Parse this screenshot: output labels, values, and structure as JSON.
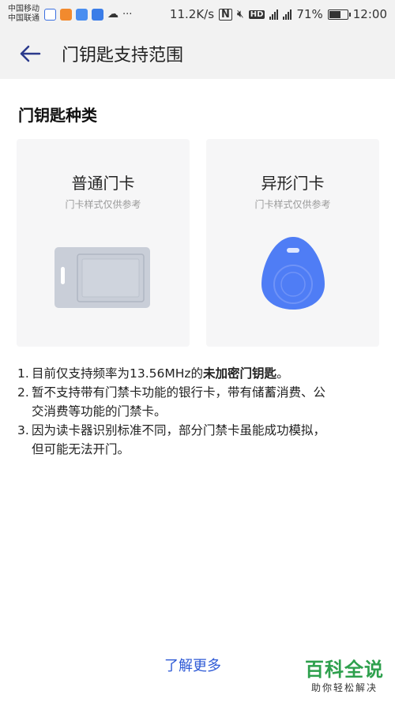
{
  "status_bar": {
    "carrier_1": "中国移动",
    "carrier_2": "中国联通",
    "speed": "11.2K/s",
    "battery": "71%",
    "battery_level": 0.71,
    "time": "12:00",
    "app_icons": [
      "baidu-icon",
      "orange-app-icon",
      "wifi-app-icon",
      "blue-app-icon",
      "cloud-icon"
    ]
  },
  "header": {
    "title": "门钥匙支持范围"
  },
  "section": {
    "title": "门钥匙种类"
  },
  "cards": [
    {
      "title": "普通门卡",
      "subtitle": "门卡样式仅供参考"
    },
    {
      "title": "异形门卡",
      "subtitle": "门卡样式仅供参考"
    }
  ],
  "notes": {
    "n1_num": "1.",
    "n1_text": "目前仅支持频率为13.56MHz的",
    "n1_bold": "未加密门钥匙",
    "n1_end": "。",
    "n2_num": "2.",
    "n2_line1": "暂不支持带有门禁卡功能的银行卡，带有储蓄消费、公",
    "n2_line2": "交消费等功能的门禁卡。",
    "n3_num": "3.",
    "n3_line1": "因为读卡器识别标准不同，部分门禁卡虽能成功模拟，",
    "n3_line2": "但可能无法开门。"
  },
  "footer": {
    "learn_more": "了解更多"
  },
  "watermark": {
    "big": "百科全说",
    "small": "助你轻松解决"
  },
  "colors": {
    "accent": "#2f5bd6",
    "fob_blue": "#4f7df5",
    "card_gray": "#c9ced8",
    "watermark_green": "#2ea04d"
  }
}
